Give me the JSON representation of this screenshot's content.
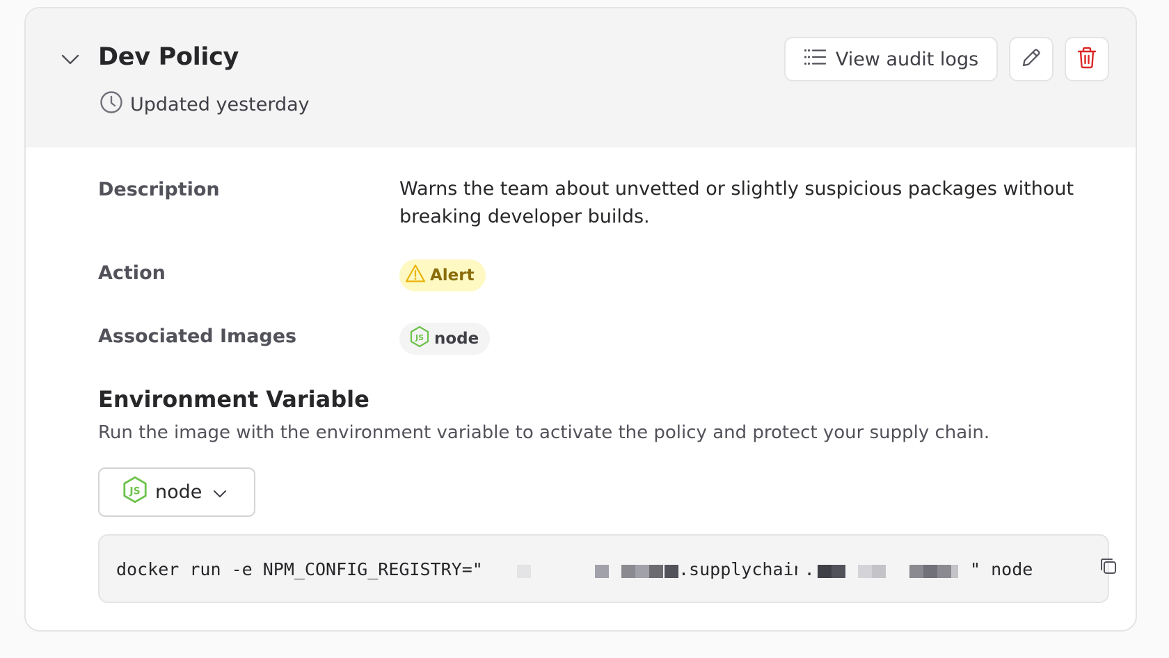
{
  "policy": {
    "title": "Dev Policy",
    "updated": "Updated yesterday"
  },
  "actions": {
    "audit_label": "View audit logs"
  },
  "details": {
    "description_label": "Description",
    "description_value": "Warns the team about unvetted or slightly suspicious packages without breaking developer builds.",
    "action_label": "Action",
    "action_value": "Alert",
    "images_label": "Associated Images",
    "images_value": "node"
  },
  "env": {
    "title": "Environment Variable",
    "description": "Run the image with the environment variable to activate the policy and protect your supply chain.",
    "selected_image": "node",
    "command_prefix": "docker run -e NPM_CONFIG_REGISTRY=\"",
    "command_mid": ".supplychain.",
    "command_suffix": "\" node"
  },
  "colors": {
    "alert_bg": "#fef9c3",
    "alert_text": "#8a6c0b",
    "alert_icon": "#eab308",
    "node_green": "#6cc24a",
    "delete_red": "#dc2626"
  },
  "icons": {
    "toggle": "chevron-down-icon",
    "updated": "clock-icon",
    "audit": "list-icon",
    "edit": "pencil-icon",
    "delete": "trash-icon",
    "alert": "warning-icon",
    "node": "nodejs-icon",
    "copy": "copy-icon"
  }
}
